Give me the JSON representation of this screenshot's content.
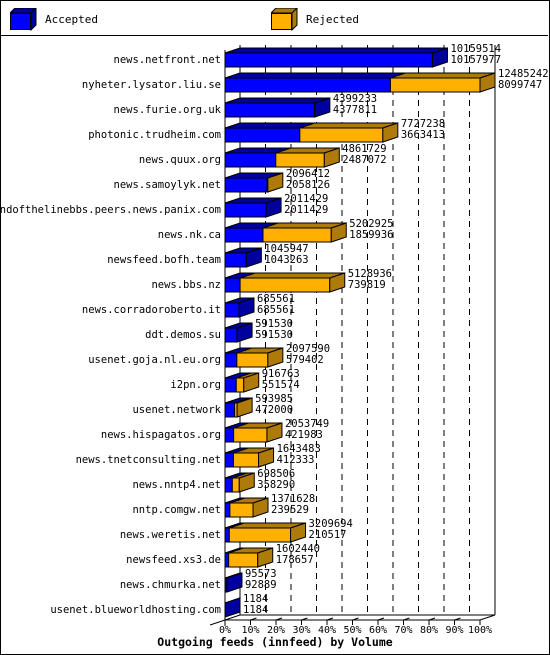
{
  "legend": {
    "accepted_label": "Accepted",
    "rejected_label": "Rejected"
  },
  "colors": {
    "accepted_front": "#0000ff",
    "accepted_side": "#00009f",
    "rejected_front": "#ffb000",
    "rejected_side": "#ae7a0a"
  },
  "chart_data": {
    "type": "bar",
    "orientation": "horizontal",
    "stacked": true,
    "style": "3d",
    "title": "Outgoing feeds (innfeed) by Volume",
    "xlabel": "",
    "ylabel": "",
    "xlim_percent": [
      0,
      100
    ],
    "x_ticks": [
      "0%",
      "10%",
      "20%",
      "30%",
      "40%",
      "50%",
      "60%",
      "70%",
      "80%",
      "90%",
      "100%"
    ],
    "grid": true,
    "legend_position": "top",
    "scale_note": "bar length relative to largest offered volume",
    "categories": [
      "news.netfront.net",
      "nyheter.lysator.liu.se",
      "news.furie.org.uk",
      "photonic.trudheim.com",
      "news.quux.org",
      "news.samoylyk.net",
      "endofthelinebbs.peers.news.panix.com",
      "news.nk.ca",
      "newsfeed.bofh.team",
      "news.bbs.nz",
      "news.corradoroberto.it",
      "ddt.demos.su",
      "usenet.goja.nl.eu.org",
      "i2pn.org",
      "usenet.network",
      "news.hispagatos.org",
      "news.tnetconsulting.net",
      "news.nntp4.net",
      "nntp.comgw.net",
      "news.weretis.net",
      "newsfeed.xs3.de",
      "news.chmurka.net",
      "usenet.blueworldhosting.com"
    ],
    "totals": [
      10159514,
      12485242,
      4399233,
      7727238,
      4861729,
      2096412,
      2011429,
      5202925,
      1045947,
      5128936,
      685561,
      591530,
      2097590,
      916763,
      593985,
      2053749,
      1643483,
      698506,
      1371628,
      3209694,
      1602440,
      95573,
      1184
    ],
    "series": [
      {
        "name": "Accepted",
        "values": [
          10157977,
          8099747,
          4377811,
          3663413,
          2487072,
          2058126,
          2011429,
          1859936,
          1043263,
          739819,
          685561,
          591530,
          579402,
          551574,
          472000,
          421983,
          412333,
          358290,
          239529,
          210517,
          178657,
          92889,
          1184
        ]
      },
      {
        "name": "Rejected",
        "values": [
          1537,
          4385495,
          21422,
          4063825,
          2374657,
          38286,
          0,
          3342989,
          2684,
          4389117,
          0,
          0,
          1518188,
          365189,
          121985,
          1631766,
          1231150,
          340216,
          1132099,
          2999177,
          1423783,
          2684,
          0
        ]
      }
    ]
  }
}
